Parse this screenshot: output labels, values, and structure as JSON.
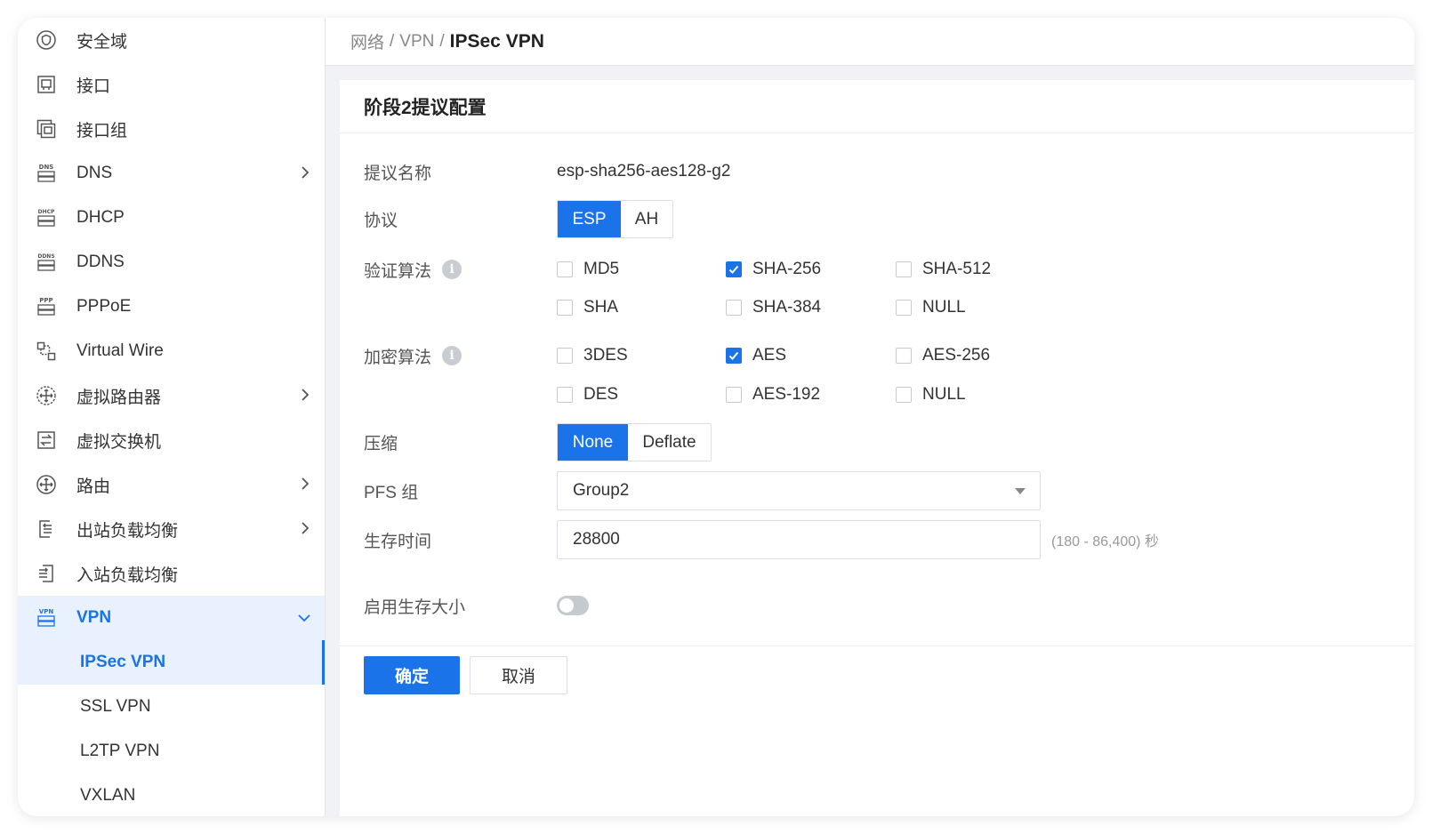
{
  "sidebar": {
    "items": [
      {
        "label": "安全域",
        "icon": "shield-circle-icon"
      },
      {
        "label": "接口",
        "icon": "interface-icon"
      },
      {
        "label": "接口组",
        "icon": "interface-group-icon"
      },
      {
        "label": "DNS",
        "icon": "dns-icon",
        "has_chevron": true
      },
      {
        "label": "DHCP",
        "icon": "dhcp-icon"
      },
      {
        "label": "DDNS",
        "icon": "ddns-icon"
      },
      {
        "label": "PPPoE",
        "icon": "pppoe-icon"
      },
      {
        "label": "Virtual Wire",
        "icon": "virtual-wire-icon"
      },
      {
        "label": "虚拟路由器",
        "icon": "virtual-router-icon",
        "has_chevron": true
      },
      {
        "label": "虚拟交换机",
        "icon": "virtual-switch-icon"
      },
      {
        "label": "路由",
        "icon": "route-icon",
        "has_chevron": true
      },
      {
        "label": "出站负载均衡",
        "icon": "outbound-lb-icon",
        "has_chevron": true
      },
      {
        "label": "入站负载均衡",
        "icon": "inbound-lb-icon"
      },
      {
        "label": "VPN",
        "icon": "vpn-icon",
        "expanded": true
      }
    ],
    "vpn_children": [
      {
        "label": "IPSec VPN",
        "active": true
      },
      {
        "label": "SSL VPN"
      },
      {
        "label": "L2TP VPN"
      },
      {
        "label": "VXLAN"
      }
    ]
  },
  "breadcrumb": {
    "parts": [
      "网络",
      "VPN"
    ],
    "current": "IPSec VPN"
  },
  "panel": {
    "title": "阶段2提议配置",
    "fields": {
      "proposal_name": {
        "label": "提议名称",
        "value": "esp-sha256-aes128-g2"
      },
      "protocol": {
        "label": "协议",
        "options": [
          "ESP",
          "AH"
        ],
        "selected": "ESP"
      },
      "auth": {
        "label": "验证算法",
        "options": [
          {
            "label": "MD5",
            "checked": false
          },
          {
            "label": "SHA-256",
            "checked": true
          },
          {
            "label": "SHA-512",
            "checked": false
          },
          {
            "label": "SHA",
            "checked": false
          },
          {
            "label": "SHA-384",
            "checked": false
          },
          {
            "label": "NULL",
            "checked": false
          }
        ]
      },
      "encryption": {
        "label": "加密算法",
        "options": [
          {
            "label": "3DES",
            "checked": false
          },
          {
            "label": "AES",
            "checked": true
          },
          {
            "label": "AES-256",
            "checked": false
          },
          {
            "label": "DES",
            "checked": false
          },
          {
            "label": "AES-192",
            "checked": false
          },
          {
            "label": "NULL",
            "checked": false
          }
        ]
      },
      "compression": {
        "label": "压缩",
        "options": [
          "None",
          "Deflate"
        ],
        "selected": "None"
      },
      "pfs": {
        "label": "PFS 组",
        "value": "Group2"
      },
      "lifetime": {
        "label": "生存时间",
        "value": "28800",
        "hint": "(180 - 86,400) 秒"
      },
      "lifesize": {
        "label": "启用生存大小",
        "enabled": false
      }
    },
    "buttons": {
      "ok": "确定",
      "cancel": "取消"
    }
  },
  "colors": {
    "accent": "#1a73e8",
    "active_bg": "#e8f1fd"
  }
}
